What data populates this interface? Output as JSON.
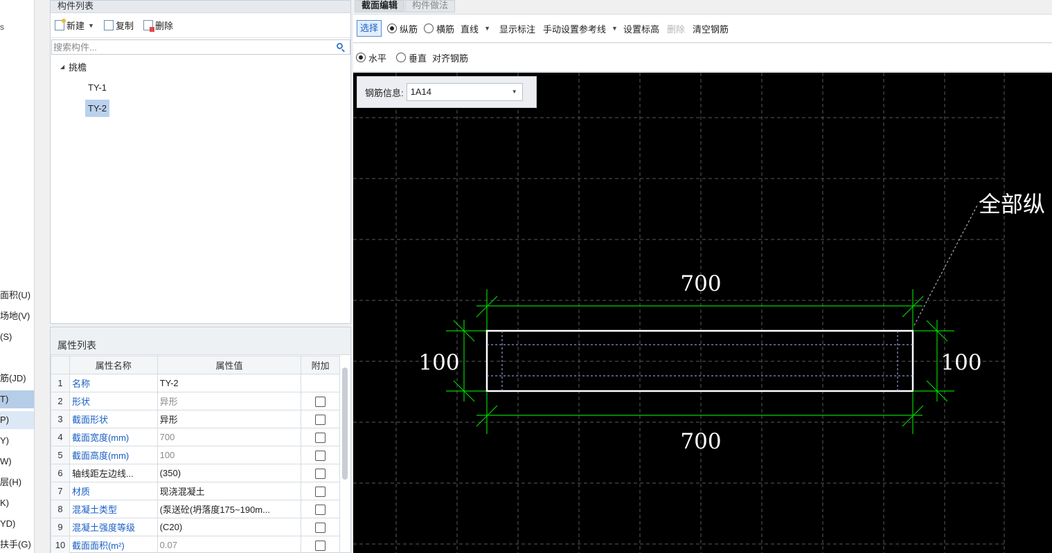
{
  "left_nav": {
    "top_mark": "s",
    "items": [
      {
        "label": "面积(U)"
      },
      {
        "label": "场地(V)"
      },
      {
        "label": "(S)"
      },
      {
        "label": "筋(JD)"
      },
      {
        "label": "T)"
      },
      {
        "label": "P)"
      },
      {
        "label": "Y)"
      },
      {
        "label": "W)"
      },
      {
        "label": "层(H)"
      },
      {
        "label": "K)"
      },
      {
        "label": "YD)"
      },
      {
        "label": "扶手(G)"
      }
    ]
  },
  "component_list": {
    "title": "构件列表",
    "toolbar": {
      "new_label": "新建",
      "copy_label": "复制",
      "delete_label": "删除"
    },
    "search_placeholder": "搜索构件...",
    "tree": {
      "root_label": "挑檐",
      "items": [
        {
          "label": "TY-1"
        },
        {
          "label": "TY-2"
        }
      ],
      "selected": "TY-2"
    }
  },
  "property_list": {
    "title": "属性列表",
    "headers": {
      "name": "属性名称",
      "value": "属性值",
      "extra": "附加"
    },
    "rows": [
      {
        "num": "1",
        "name": "名称",
        "value": "TY-2"
      },
      {
        "num": "2",
        "name": "形状",
        "value": "异形"
      },
      {
        "num": "3",
        "name": "截面形状",
        "value": "异形"
      },
      {
        "num": "4",
        "name": "截面宽度(mm)",
        "value": "700"
      },
      {
        "num": "5",
        "name": "截面高度(mm)",
        "value": "100"
      },
      {
        "num": "6",
        "name": "轴线距左边线...",
        "value": "(350)"
      },
      {
        "num": "7",
        "name": "材质",
        "value": "现浇混凝土"
      },
      {
        "num": "8",
        "name": "混凝土类型",
        "value": "(泵送砼(坍落度175~190m..."
      },
      {
        "num": "9",
        "name": "混凝土强度等级",
        "value": "(C20)"
      },
      {
        "num": "10",
        "name": "截面面积(m²)",
        "value": "0.07"
      }
    ]
  },
  "tabs": [
    {
      "label": "截面编辑"
    },
    {
      "label": "构件做法"
    }
  ],
  "toolbar1": {
    "select_label": "选择",
    "radio_longitudinal": "纵筋",
    "radio_transverse": "横筋",
    "straight_label": "直线",
    "show_annotation": "显示标注",
    "manual_ref_line": "手动设置参考线",
    "set_elevation": "设置标高",
    "delete_label": "删除",
    "clear_rebar": "清空钢筋"
  },
  "toolbar2": {
    "horizontal_label": "水平",
    "vertical_label": "垂直",
    "align_rebar": "对齐钢筋"
  },
  "canvas": {
    "rebar_info_label": "钢筋信息:",
    "rebar_info_value": "1A14",
    "dim_top": "700",
    "dim_bottom": "700",
    "dim_left": "100",
    "dim_right": "100",
    "annotation": "全部纵"
  },
  "colors": {
    "canvas_bg": "#000000",
    "dimension_line": "#00d400",
    "section_outline": "#ffffff",
    "accent_blue": "#1a5fc6"
  }
}
